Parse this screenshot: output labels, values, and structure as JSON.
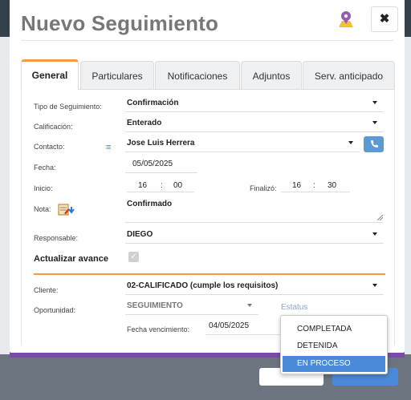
{
  "modal": {
    "title": "Nuevo Seguimiento",
    "close_label": "✖"
  },
  "tabs": [
    "General",
    "Particulares",
    "Notificaciones",
    "Adjuntos",
    "Serv. anticipado"
  ],
  "form": {
    "tipo_label": "Tipo de Seguimiento:",
    "tipo_value": "Confirmación",
    "calificacion_label": "Calificación:",
    "calificacion_value": "Enterado",
    "contacto_label": "Contacto:",
    "contacto_value": "Jose Luis Herrera",
    "fecha_label": "Fecha:",
    "fecha_value": "05/05/2025",
    "inicio_label": "Inicio:",
    "inicio_hour": "16",
    "inicio_min": "00",
    "time_sep": ":",
    "finalizo_label": "Finalizó:",
    "finalizo_hour": "16",
    "finalizo_min": "30",
    "nota_label": "Nota:",
    "nota_value": "Confirmado",
    "responsable_label": "Responsable:",
    "responsable_value": "DIEGO",
    "actualizar_label": "Actualizar avance",
    "cliente_label": "Cliente:",
    "cliente_value": "02-CALIFICADO (cumple los requisitos)",
    "oportunidad_label": "Oportunidad:",
    "oportunidad_value": "SEGUIMIENTO",
    "estatus_placeholder": "Estatus",
    "vencimiento_label": "Fecha vencimiento:",
    "vencimiento_value": "04/05/2025"
  },
  "estatus_options": [
    "COMPLETADA",
    "DETENIDA",
    "EN PROCESO"
  ],
  "estatus_selected_index": 2,
  "colors": {
    "accent": "#f39c3c",
    "primary": "#4a8ad8",
    "purple": "#7b4aa8"
  }
}
